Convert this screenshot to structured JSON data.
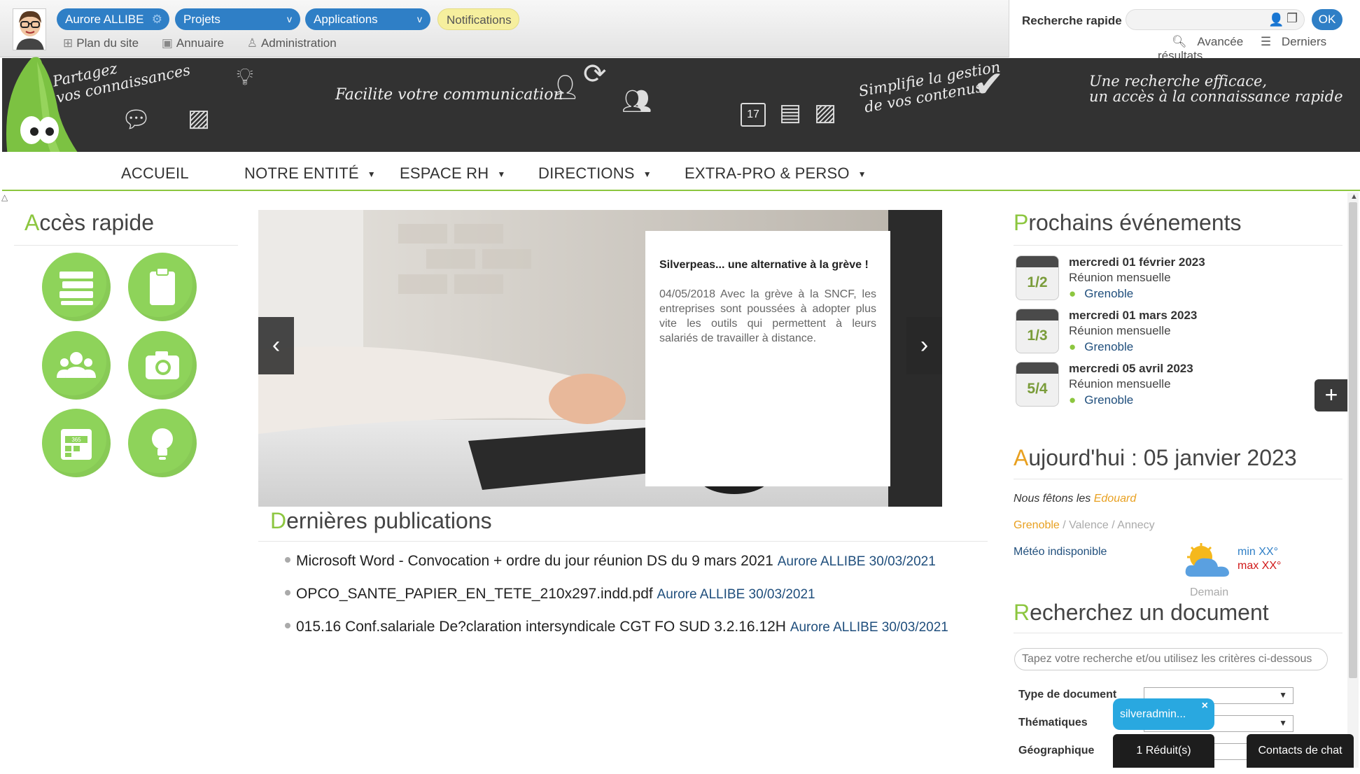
{
  "header": {
    "user_label": "Aurore ALLIBE",
    "projects_label": "Projets",
    "applications_label": "Applications",
    "notifications_label": "Notifications",
    "links": {
      "site_map": "Plan du site",
      "directory": "Annuaire",
      "admin": "Administration"
    }
  },
  "quick_search": {
    "label": "Recherche rapide",
    "value": "",
    "ok_label": "OK",
    "advanced_label": "Avancée",
    "recent_label": "Derniers résultats"
  },
  "banner": {
    "t1a": "Partagez",
    "t1b": "vos connaissances",
    "t2": "Facilite votre communication",
    "t3a": "Simplifie la gestion",
    "t3b": "de vos contenus",
    "t4a": "Une recherche efficace,",
    "t4b": "un accès à la connaissance rapide",
    "calendar_day": "17"
  },
  "nav": {
    "items": [
      "ACCUEIL",
      "NOTRE ENTITÉ",
      "ESPACE RH",
      "DIRECTIONS",
      "EXTRA-PRO & PERSO"
    ]
  },
  "quick_access": {
    "title_first": "A",
    "title_rest": "ccès rapide",
    "calendar_mini": "365"
  },
  "carousel": {
    "title": "Silverpeas... une alternative à la grève !",
    "text": "04/05/2018 Avec la grève à la SNCF, les entreprises sont poussées à adopter plus vite les outils qui permettent à leurs salariés de travailler à distance.",
    "prev": "‹",
    "next": "›"
  },
  "publications": {
    "title_first": "D",
    "title_rest": "ernières publications",
    "items": [
      {
        "title": "Microsoft Word - Convocation + ordre du jour réunion DS du 9 mars 2021",
        "meta": "Aurore ALLIBE 30/03/2021"
      },
      {
        "title": "OPCO_SANTE_PAPIER_EN_TETE_210x297.indd.pdf",
        "meta": "Aurore ALLIBE 30/03/2021"
      },
      {
        "title": "015.16 Conf.salariale De?claration intersyndicale CGT FO SUD 3.2.16.12H",
        "meta": "Aurore ALLIBE 30/03/2021"
      }
    ]
  },
  "events": {
    "title_first": "P",
    "title_rest": "rochains événements",
    "items": [
      {
        "day": "1",
        "month": "2",
        "date": "mercredi 01 février 2023",
        "title": "Réunion mensuelle",
        "location": "Grenoble"
      },
      {
        "day": "1",
        "month": "3",
        "date": "mercredi 01 mars 2023",
        "title": "Réunion mensuelle",
        "location": "Grenoble"
      },
      {
        "day": "5",
        "month": "4",
        "date": "mercredi 05 avril 2023",
        "title": "Réunion mensuelle",
        "location": "Grenoble"
      }
    ],
    "add_label": "+"
  },
  "today": {
    "title_first": "A",
    "title_rest": "ujourd'hui : 05 janvier 2023",
    "fete_prefix": "Nous fêtons les",
    "fete_name": "Edouard",
    "cities": [
      "Grenoble",
      "Valence",
      "Annecy"
    ],
    "city_sep": " / ",
    "meteo_label": "Météo indisponible",
    "min": "min XX°",
    "max": "max XX°",
    "demain": "Demain"
  },
  "doc_search": {
    "title_first": "R",
    "title_rest": "echerchez un document",
    "placeholder": "Tapez votre recherche et/ou utilisez les critères ci-dessous",
    "labels": {
      "type": "Type de document",
      "themes": "Thématiques",
      "geo": "Géographique"
    }
  },
  "chat": {
    "bubble": "silveradmin...",
    "close": "×",
    "reduced": "1 Réduit(s)",
    "contacts": "Contacts de chat"
  },
  "colors": {
    "accent_green": "#8cc63f",
    "brand_blue": "#2f7fc6",
    "orange": "#e8a020",
    "dark_banner": "#323232"
  }
}
